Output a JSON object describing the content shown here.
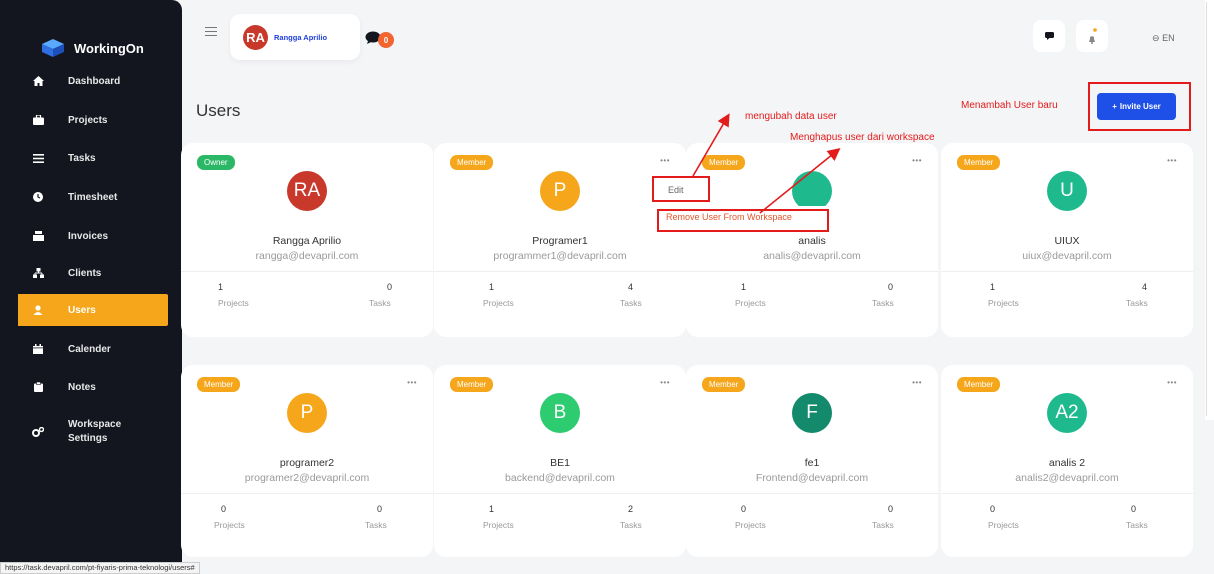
{
  "app": {
    "name": "WorkingOn"
  },
  "sidebar": {
    "items": [
      {
        "label": "Dashboard",
        "icon": "home-icon"
      },
      {
        "label": "Projects",
        "icon": "briefcase-icon"
      },
      {
        "label": "Tasks",
        "icon": "list-icon"
      },
      {
        "label": "Timesheet",
        "icon": "clock-icon"
      },
      {
        "label": "Invoices",
        "icon": "invoice-icon"
      },
      {
        "label": "Clients",
        "icon": "clients-icon"
      },
      {
        "label": "Users",
        "icon": "user-icon",
        "active": true
      },
      {
        "label": "Calender",
        "icon": "calendar-icon"
      },
      {
        "label": "Notes",
        "icon": "note-icon"
      },
      {
        "label": "Workspace",
        "label2": "Settings",
        "icon": "settings-icon"
      }
    ]
  },
  "topbar": {
    "user_initials": "RA",
    "user_name": "Rangga Aprilio",
    "chat_count": "0",
    "lang": "EN"
  },
  "page": {
    "title": "Users",
    "invite_label": "Invite User"
  },
  "annotations": {
    "edit": "mengubah data user",
    "remove": "Menghapus user dari workspace",
    "invite": "Menambah User baru"
  },
  "menu": {
    "edit": "Edit",
    "remove": "Remove User From Workspace"
  },
  "users": [
    {
      "role": "Owner",
      "initials": "RA",
      "name": "Rangga Aprilio",
      "email": "rangga@devapril.com",
      "projects": "1",
      "tasks": "0",
      "color": "#c8392b"
    },
    {
      "role": "Member",
      "initials": "P",
      "name": "Programer1",
      "email": "programmer1@devapril.com",
      "projects": "1",
      "tasks": "4",
      "color": "#f6a61b"
    },
    {
      "role": "Member",
      "initials": "",
      "name": "analis",
      "email": "analis@devapril.com",
      "projects": "1",
      "tasks": "0",
      "color": "#1fb98e"
    },
    {
      "role": "Member",
      "initials": "U",
      "name": "UIUX",
      "email": "uiux@devapril.com",
      "projects": "1",
      "tasks": "4",
      "color": "#1fb98e"
    },
    {
      "role": "Member",
      "initials": "P",
      "name": "programer2",
      "email": "programer2@devapril.com",
      "projects": "0",
      "tasks": "0",
      "color": "#f6a61b"
    },
    {
      "role": "Member",
      "initials": "B",
      "name": "BE1",
      "email": "backend@devapril.com",
      "projects": "1",
      "tasks": "2",
      "color": "#2ecc71"
    },
    {
      "role": "Member",
      "initials": "F",
      "name": "fe1",
      "email": "Frontend@devapril.com",
      "projects": "0",
      "tasks": "0",
      "color": "#138a6b"
    },
    {
      "role": "Member",
      "initials": "A2",
      "name": "analis 2",
      "email": "analis2@devapril.com",
      "projects": "0",
      "tasks": "0",
      "color": "#1fb98e"
    }
  ],
  "labels": {
    "projects": "Projects",
    "tasks": "Tasks"
  },
  "status_url": "https://task.devapril.com/pt-fiyaris-prima-teknologi/users#"
}
